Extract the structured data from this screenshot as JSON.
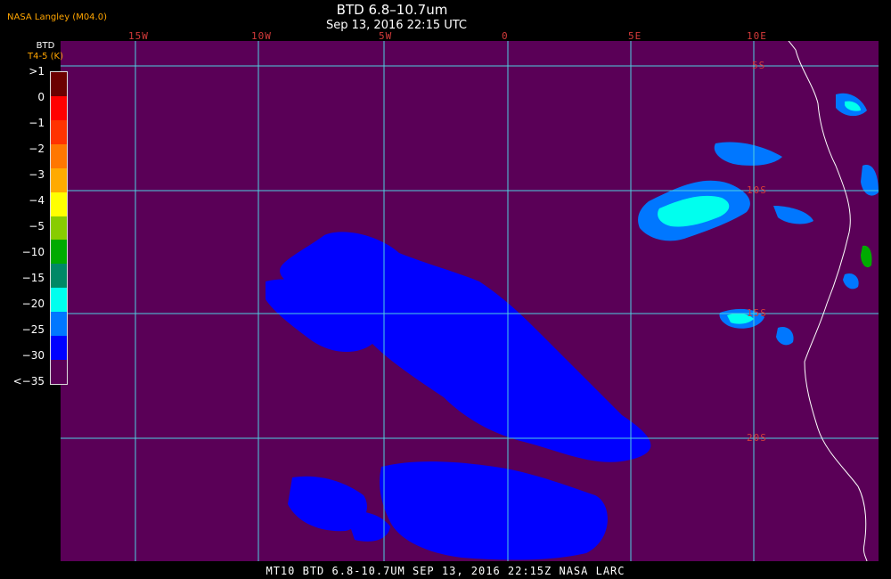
{
  "header": {
    "brand": "NASA Langley (M04.0)",
    "title": "BTD 6.8–10.7um",
    "subtitle": "Sep 13, 2016 22:15 UTC"
  },
  "legend": {
    "title": "BTD",
    "unit": "T4-5 (K)",
    "levels": [
      {
        "label": ">1",
        "color": "#6b0000"
      },
      {
        "label": "0",
        "color": "#ff0000"
      },
      {
        "label": "−1",
        "color": "#ff3300"
      },
      {
        "label": "−2",
        "color": "#ff7700"
      },
      {
        "label": "−3",
        "color": "#ffaa00"
      },
      {
        "label": "−4",
        "color": "#ffff00"
      },
      {
        "label": "−5",
        "color": "#88cc00"
      },
      {
        "label": "−10",
        "color": "#00aa00"
      },
      {
        "label": "−15",
        "color": "#008866"
      },
      {
        "label": "−20",
        "color": "#00ffee"
      },
      {
        "label": "−25",
        "color": "#0077ff"
      },
      {
        "label": "−30",
        "color": "#0000ff"
      },
      {
        "label": "<−35",
        "color": "#5a0057"
      }
    ]
  },
  "map": {
    "lon_labels": [
      "15W",
      "10W",
      "5W",
      "0",
      "5E",
      "10E"
    ],
    "lat_labels": [
      "5S",
      "10S",
      "15S",
      "20S"
    ],
    "colors": {
      "background": "#5a0057",
      "grid": "#4fd0e0",
      "coast": "#ffffff",
      "cloud_blue": "#0000ff",
      "cloud_mid": "#0077ff",
      "cloud_cyan": "#00ffee",
      "cloud_green": "#00aa00"
    }
  },
  "footer": {
    "text": "MT10  BTD 6.8-10.7UM  SEP 13, 2016 22:15Z  NASA LARC"
  }
}
